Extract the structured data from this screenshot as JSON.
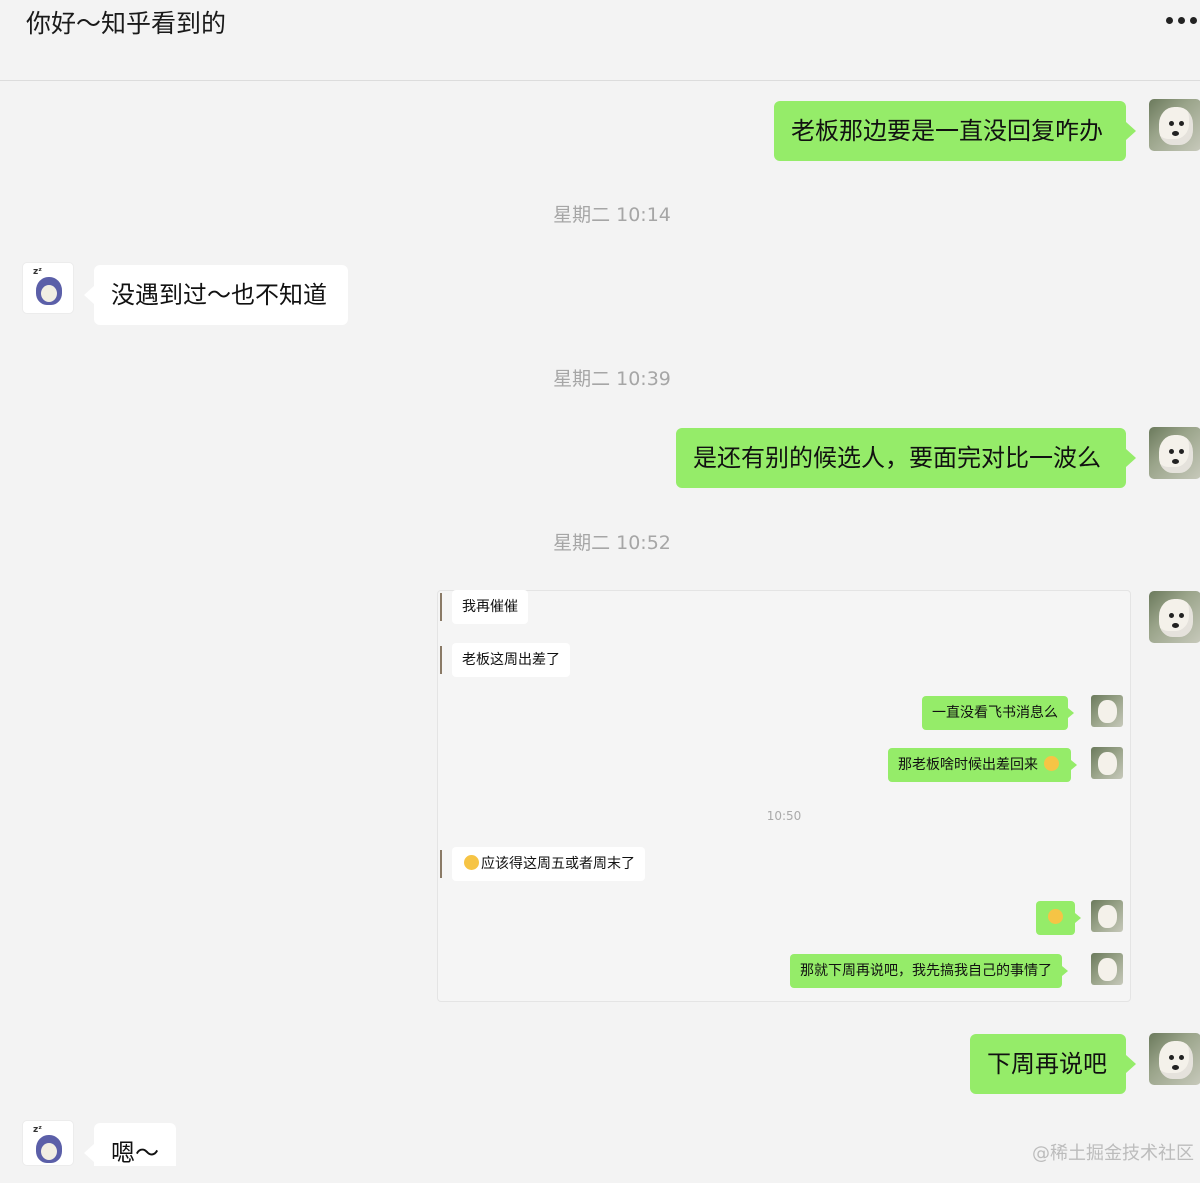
{
  "header": {
    "title": "你好～知乎看到的"
  },
  "timestamps": [
    "星期二 10:14",
    "星期二 10:39",
    "星期二 10:52"
  ],
  "messages": [
    {
      "side": "me",
      "text": "老板那边要是一直没回复咋办"
    },
    {
      "side": "them",
      "text": "没遇到过～也不知道"
    },
    {
      "side": "me",
      "text": "是还有别的候选人，要面完对比一波么"
    },
    {
      "side": "me",
      "text": "下周再说吧"
    },
    {
      "side": "them",
      "text": "嗯～"
    }
  ],
  "forwarded": {
    "messages": [
      {
        "side": "them",
        "text": "我再催催"
      },
      {
        "side": "them",
        "text": "老板这周出差了"
      },
      {
        "side": "me",
        "text": "一直没看飞书消息么"
      },
      {
        "side": "me",
        "text": "那老板啥时候出差回来"
      },
      {
        "side": "them",
        "text": "应该得这周五或者周末了"
      },
      {
        "side": "me",
        "text": ""
      },
      {
        "side": "me",
        "text": "那就下周再说吧，我先搞我自己的事情了"
      }
    ],
    "time": "10:50"
  },
  "watermark": "@稀土掘金技术社区",
  "colors": {
    "my_bubble": "#95ec69",
    "their_bubble": "#ffffff",
    "background": "#f3f3f3"
  }
}
